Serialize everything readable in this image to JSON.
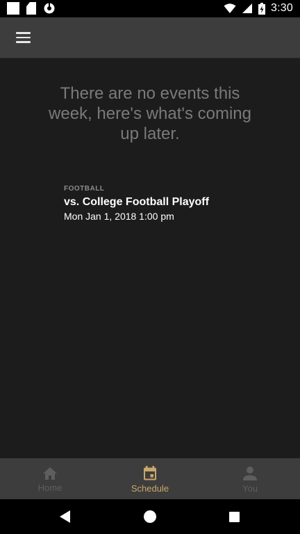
{
  "status_bar": {
    "time": "3:30",
    "icons": [
      "notification-square-icon",
      "sd-card-icon",
      "sync-icon",
      "wifi-icon",
      "cellular-icon",
      "battery-charging-icon"
    ]
  },
  "app_bar": {
    "menu_icon": "hamburger-menu-icon"
  },
  "main": {
    "empty_message": "There are no events this week, here's what's coming up later.",
    "events": [
      {
        "category": "FOOTBALL",
        "title": "vs. College Football Playoff",
        "date": "Mon Jan 1, 2018 1:00 pm"
      }
    ]
  },
  "bottom_nav": {
    "items": [
      {
        "label": "Home",
        "icon": "home-icon",
        "active": false
      },
      {
        "label": "Schedule",
        "icon": "calendar-icon",
        "active": true
      },
      {
        "label": "You",
        "icon": "person-icon",
        "active": false
      }
    ]
  },
  "colors": {
    "accent": "#c9a86a",
    "inactive": "#5e5e5e",
    "app_bar_bg": "#3d3d3d",
    "content_bg": "#1c1c1c"
  }
}
